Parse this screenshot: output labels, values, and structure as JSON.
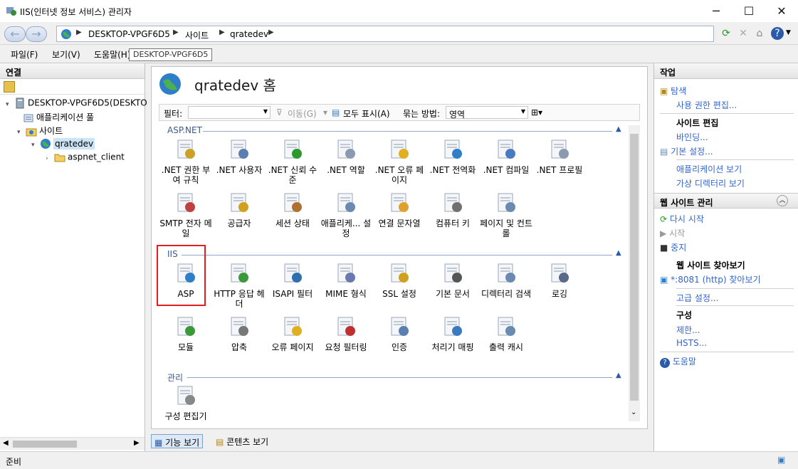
{
  "window": {
    "title": "IIS(인터넷 정보 서비스) 관리자",
    "minimize": "─",
    "maximize": "☐",
    "close": "✕"
  },
  "address": {
    "crumbs": [
      "DESKTOP-VPGF6D5",
      "사이트",
      "qratedev"
    ]
  },
  "menu": {
    "items": [
      "파일(F)",
      "보기(V)",
      "도움말(H)"
    ],
    "tooltip": "DESKTOP-VPGF6D5"
  },
  "connections": {
    "header": "연결",
    "tree": [
      {
        "label": "DESKTOP-VPGF6D5(DESKTO",
        "icon": "server-icon"
      },
      {
        "label": "애플리케이션 풀",
        "icon": "app-pool-icon"
      },
      {
        "label": "사이트",
        "icon": "sites-folder-icon"
      },
      {
        "label": "qratedev",
        "icon": "globe-icon"
      },
      {
        "label": "aspnet_client",
        "icon": "folder-icon"
      }
    ]
  },
  "center": {
    "title": "qratedev 홈",
    "filter_label": "필터:",
    "go_label": "이동(G)",
    "show_all_label": "모두 표시(A)",
    "group_by_label": "묶는 방법:",
    "group_by_value": "영역",
    "groups": [
      {
        "name": "ASP.NET",
        "features": [
          {
            "label": ".NET 권한 부여 규칙",
            "icon": "lock-doc-icon"
          },
          {
            "label": ".NET 사용자",
            "icon": "users-icon"
          },
          {
            "label": ".NET 신뢰 수준",
            "icon": "trust-check-icon"
          },
          {
            "label": ".NET 역할",
            "icon": "role-doc-icon"
          },
          {
            "label": ".NET 오류 페이지",
            "icon": "error-page-icon"
          },
          {
            "label": ".NET 전역화",
            "icon": "globe-icon"
          },
          {
            "label": ".NET 컴파일",
            "icon": "compile-icon"
          },
          {
            "label": ".NET 프로필",
            "icon": "profile-icon"
          },
          {
            "label": "SMTP 전자 메일",
            "icon": "mail-icon"
          },
          {
            "label": "공급자",
            "icon": "provider-icon"
          },
          {
            "label": "세션 상태",
            "icon": "session-icon"
          },
          {
            "label": "애플리케... 설정",
            "icon": "app-settings-icon"
          },
          {
            "label": "연결 문자열",
            "icon": "connection-string-icon"
          },
          {
            "label": "컴퓨터 키",
            "icon": "machine-key-icon"
          },
          {
            "label": "페이지 및 컨트롤",
            "icon": "pages-controls-icon"
          }
        ]
      },
      {
        "name": "IIS",
        "features": [
          {
            "label": "ASP",
            "icon": "asp-icon"
          },
          {
            "label": "HTTP 응답 헤더",
            "icon": "http-header-icon"
          },
          {
            "label": "ISAPI 필터",
            "icon": "isapi-filter-icon"
          },
          {
            "label": "MIME 형식",
            "icon": "mime-icon"
          },
          {
            "label": "SSL 설정",
            "icon": "padlock-icon"
          },
          {
            "label": "기본 문서",
            "icon": "default-doc-icon"
          },
          {
            "label": "디렉터리 검색",
            "icon": "dir-browse-icon"
          },
          {
            "label": "로깅",
            "icon": "logging-icon"
          },
          {
            "label": "모듈",
            "icon": "modules-icon"
          },
          {
            "label": "압축",
            "icon": "compress-icon"
          },
          {
            "label": "오류 페이지",
            "icon": "error-page-icon"
          },
          {
            "label": "요청 필터링",
            "icon": "request-filter-icon"
          },
          {
            "label": "인증",
            "icon": "auth-icon"
          },
          {
            "label": "처리기 매핑",
            "icon": "handler-icon"
          },
          {
            "label": "출력 캐시",
            "icon": "output-cache-icon"
          }
        ]
      },
      {
        "name": "관리",
        "features": [
          {
            "label": "구성 편집기",
            "icon": "config-editor-icon"
          }
        ]
      }
    ],
    "tab_features": "기능 보기",
    "tab_content": "콘텐츠 보기"
  },
  "actions": {
    "header": "작업",
    "explore": "탐색",
    "edit_perms": "사용 권한 편집...",
    "site_edit_hdr": "사이트 편집",
    "bindings": "바인딩...",
    "basic_settings": "기본 설정...",
    "view_apps": "애플리케이션 보기",
    "view_vdirs": "가상 디렉터리 보기",
    "manage_hdr": "웹 사이트 관리",
    "restart": "다시 시작",
    "start": "시작",
    "stop": "중지",
    "browse_hdr": "웹 사이트 찾아보기",
    "browse_link": "*:8081 (http) 찾아보기",
    "advanced": "고급 설정...",
    "config_hdr": "구성",
    "limits": "제한...",
    "hsts": "HSTS...",
    "help": "도움말"
  },
  "status": {
    "text": "준비"
  },
  "colors": {
    "accent": "#3366cc",
    "highlight": "#e02020"
  }
}
